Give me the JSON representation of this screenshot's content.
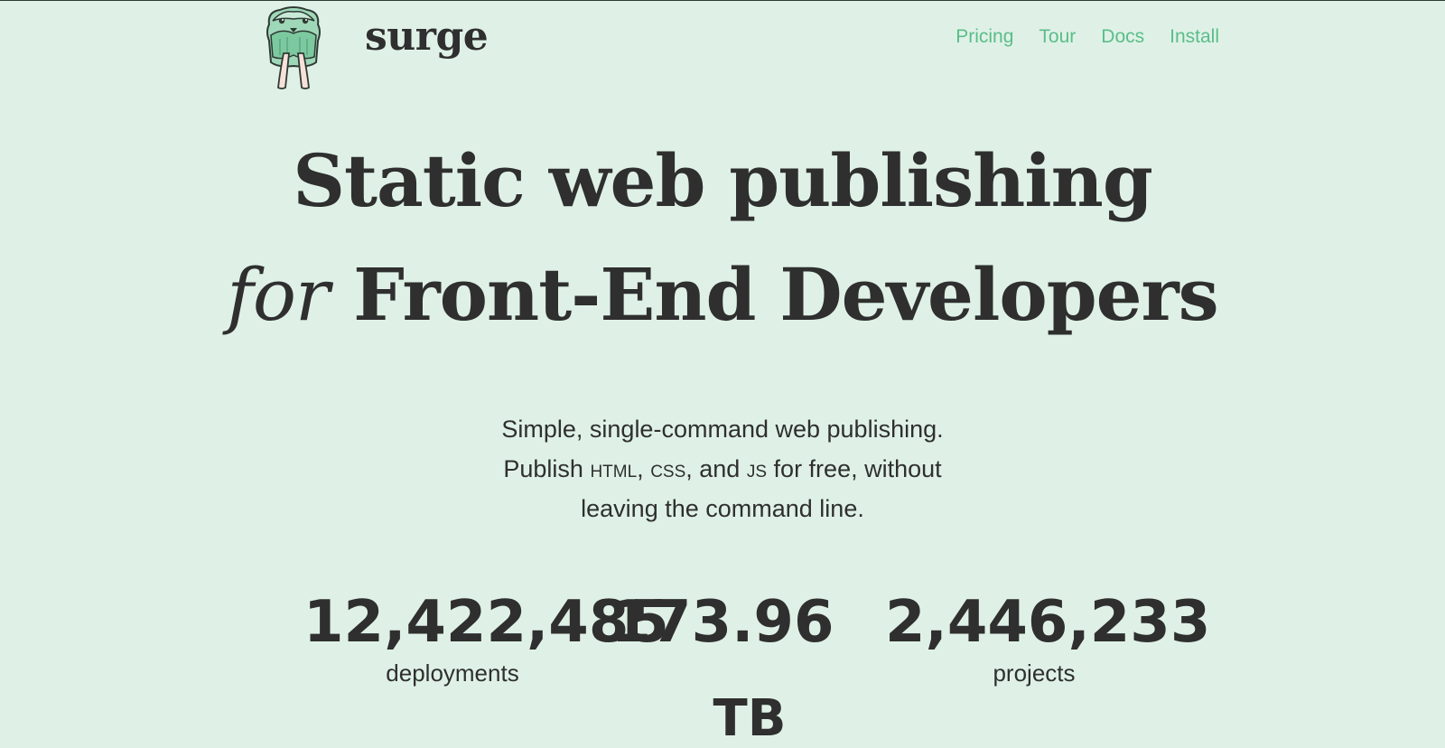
{
  "brand": {
    "name": "surge",
    "logo_icon": "walrus-logo-icon"
  },
  "nav": {
    "items": [
      {
        "label": "Pricing"
      },
      {
        "label": "Tour"
      },
      {
        "label": "Docs"
      },
      {
        "label": "Install"
      }
    ],
    "color": "#5bbd8a"
  },
  "hero": {
    "line1": "Static web publishing",
    "line2_italic": "for",
    "line2_rest": "Front-End Developers"
  },
  "tagline": {
    "line1": "Simple, single-command web publishing.",
    "line2_prefix": "Publish",
    "html_token": "HTML",
    "css_token": "CSS",
    "line2_middle": ", and",
    "js_token": "JS",
    "line2_suffix": "for free, without",
    "line3": "leaving the command line."
  },
  "stats": {
    "deployments_value": "12,422,485",
    "deployments_label": "deployments",
    "data_value": "173.96",
    "data_unit": "TB",
    "projects_value": "2,446,233",
    "projects_label": "projects"
  },
  "colors": {
    "background": "#dff1e6",
    "text": "#2f2f2f",
    "accent": "#5bbd8a"
  }
}
